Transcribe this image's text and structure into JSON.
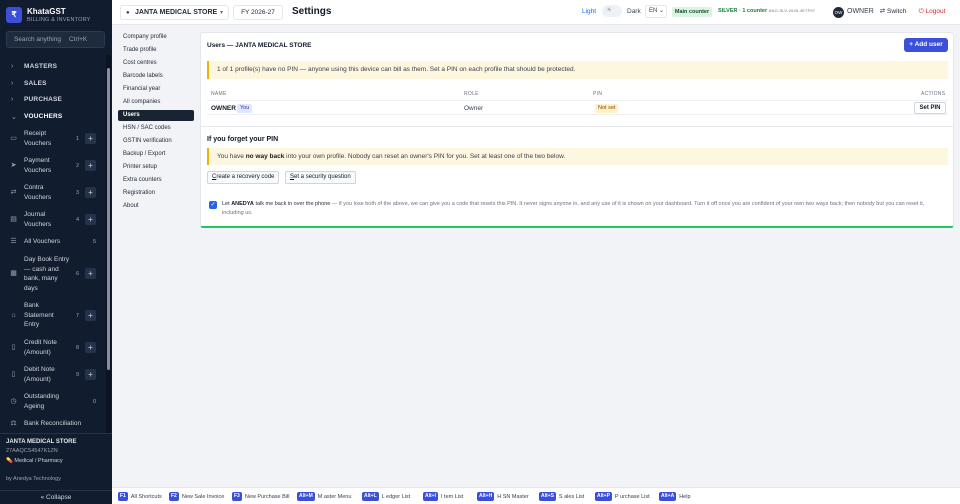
{
  "app": {
    "name": "KhataGST",
    "subtitle": "BILLING & INVENTORY",
    "logo": "₹",
    "colors": {
      "sidebar_bg": "#111c2e",
      "accent": "#3b4fd9",
      "success": "#22c55e",
      "warning_bg": "#fef7e0",
      "danger": "#dc2626"
    }
  },
  "sidebar": {
    "search_placeholder": "Search anything",
    "search_shortcut": "Ctrl+K",
    "groups": [
      {
        "label": "MASTERS",
        "icon": "chevron-right-icon",
        "glyph": "›"
      },
      {
        "label": "SALES",
        "icon": "chevron-right-icon",
        "glyph": "›"
      },
      {
        "label": "PURCHASE",
        "icon": "chevron-right-icon",
        "glyph": "›"
      },
      {
        "label": "VOUCHERS",
        "icon": "chevron-down-icon",
        "glyph": "⌄"
      }
    ],
    "vouchers": [
      {
        "label": "Receipt Vouchers",
        "num": "1",
        "icon": "receipt-icon",
        "glyph": "▭",
        "plus": "+"
      },
      {
        "label": "Payment Vouchers",
        "num": "2",
        "icon": "send-icon",
        "glyph": "➤",
        "plus": "+"
      },
      {
        "label": "Contra Vouchers",
        "num": "3",
        "icon": "swap-icon",
        "glyph": "⇄",
        "plus": "+"
      },
      {
        "label": "Journal Vouchers",
        "num": "4",
        "icon": "book-icon",
        "glyph": "▤",
        "plus": "+"
      },
      {
        "label": "All Vouchers",
        "num": "5",
        "icon": "list-icon",
        "glyph": "☰"
      },
      {
        "label": "Day Book Entry — cash and bank, many days",
        "num": "6",
        "icon": "calendar-icon",
        "glyph": "▦",
        "plus": "+"
      },
      {
        "label": "Bank Statement Entry",
        "num": "7",
        "icon": "bank-icon",
        "glyph": "⌂",
        "plus": "+"
      },
      {
        "label": "Credit Note (Amount)",
        "num": "8",
        "icon": "document-icon",
        "glyph": "▯",
        "plus": "+"
      },
      {
        "label": "Debit Note (Amount)",
        "num": "9",
        "icon": "document-icon",
        "glyph": "▯",
        "plus": "+"
      },
      {
        "label": "Outstanding Ageing",
        "num": "0",
        "icon": "clock-icon",
        "glyph": "◷"
      },
      {
        "label": "Bank Reconciliation",
        "icon": "scale-icon",
        "glyph": "⚖"
      }
    ],
    "footer": {
      "store": "JANTA MEDICAL STORE",
      "gstin": "27AAQCS4547K1ZN",
      "type_icon": "pill-icon",
      "type": "Medical / Pharmacy",
      "by": "by Anedya Technology",
      "collapse": "« Collapse"
    }
  },
  "topbar": {
    "store": "JANTA MEDICAL STORE",
    "store_caret": "▾",
    "fy": "FY 2026-27",
    "title": "Settings",
    "theme_light": "Light",
    "theme_dark": "Dark",
    "lang": "EN",
    "counter": "Main counter",
    "license": "SILVER · 1 counter",
    "license_key": "ANO-SLV-2026-4E7F97",
    "avatar": "OW",
    "user": "OWNER",
    "switch": "⇄ Switch",
    "logout": "⏻ Logout"
  },
  "settings_nav": [
    "Company profile",
    "Trade profile",
    "Cost centres",
    "Barcode labels",
    "Financial year",
    "All companies",
    "Users",
    "HSN / SAC codes",
    "GSTIN verification",
    "Backup / Export",
    "Printer setup",
    "Extra counters",
    "Registration",
    "About"
  ],
  "settings_nav_active": "Users",
  "users": {
    "title": "Users — JANTA MEDICAL STORE",
    "add_button": "+ Add user",
    "warning": "1 of 1 profile(s) have no PIN — anyone using this device can bill as them. Set a PIN on each profile that should be protected.",
    "columns": [
      "NAME",
      "ROLE",
      "PIN",
      "ACTIONS"
    ],
    "rows": [
      {
        "name": "OWNER",
        "badge": "You",
        "role": "Owner",
        "pin": "Not set",
        "action": "Set PIN"
      }
    ]
  },
  "forgot_pin": {
    "title": "If you forget your PIN",
    "note_pre": "You have ",
    "note_bold": "no way back",
    "note_post": " into your own profile. Nobody can reset an owner's PIN for you. Set at least one of the two below.",
    "recovery_btn_u": "C",
    "recovery_btn": "reate a recovery code",
    "security_btn_u": "S",
    "security_btn": "et a security question",
    "checkbox_checked": true,
    "checkbox_pre": "Let ",
    "checkbox_bold": "ANEDYA",
    "checkbox_lead": " talk me back in over the phone",
    "checkbox_rest": " — if you lose both of the above, we can give you a code that resets this PIN. It never signs anyone in, and any use of it is shown on your dashboard. Turn it off once you are confident of your own two ways back; then nobody but you can reset it, including us."
  },
  "shortcuts": [
    {
      "key": "F1",
      "label": "All Shortcuts"
    },
    {
      "key": "F2",
      "label": "New Sale Invoice"
    },
    {
      "key": "F3",
      "label": "New Purchase Bill"
    },
    {
      "key": "Alt+M",
      "label": "M aster Menu"
    },
    {
      "key": "Alt+L",
      "label": "L edger List"
    },
    {
      "key": "Alt+I",
      "label": "I tem List"
    },
    {
      "key": "Alt+H",
      "label": "H SN Master"
    },
    {
      "key": "Alt+S",
      "label": "S ales List"
    },
    {
      "key": "Alt+P",
      "label": "P urchase List"
    },
    {
      "key": "Alt+A",
      "label": "Help"
    }
  ]
}
